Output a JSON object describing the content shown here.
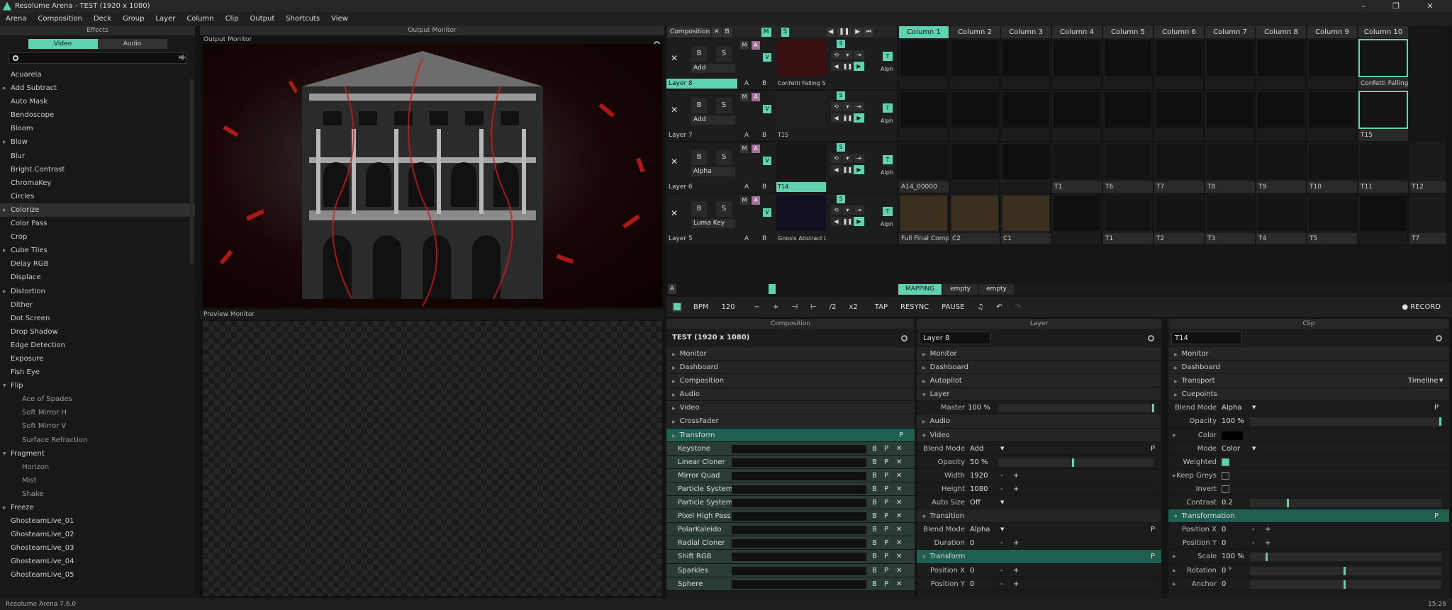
{
  "window": {
    "title": "Resolume Arena - TEST (1920 x 1080)",
    "min": "–",
    "max": "❐",
    "close": "✕"
  },
  "menu": [
    "Arena",
    "Composition",
    "Deck",
    "Group",
    "Layer",
    "Column",
    "Clip",
    "Output",
    "Shortcuts",
    "View"
  ],
  "effects": {
    "title": "Effects",
    "tab_video": "Video",
    "tab_audio": "Audio",
    "search_placeholder": "",
    "items": [
      {
        "label": "Acuarela",
        "type": "item"
      },
      {
        "label": "Add Subtract",
        "type": "expand"
      },
      {
        "label": "Auto Mask",
        "type": "item"
      },
      {
        "label": "Bendoscope",
        "type": "item"
      },
      {
        "label": "Bloom",
        "type": "item"
      },
      {
        "label": "Blow",
        "type": "expand"
      },
      {
        "label": "Blur",
        "type": "item"
      },
      {
        "label": "Bright.Contrast",
        "type": "item"
      },
      {
        "label": "ChromaKey",
        "type": "item"
      },
      {
        "label": "Circles",
        "type": "item"
      },
      {
        "label": "Colorize",
        "type": "expand",
        "selected": true
      },
      {
        "label": "Color Pass",
        "type": "item"
      },
      {
        "label": "Crop",
        "type": "item"
      },
      {
        "label": "Cube Tiles",
        "type": "expand"
      },
      {
        "label": "Delay RGB",
        "type": "item"
      },
      {
        "label": "Displace",
        "type": "item"
      },
      {
        "label": "Distortion",
        "type": "expand"
      },
      {
        "label": "Dither",
        "type": "item"
      },
      {
        "label": "Dot Screen",
        "type": "item"
      },
      {
        "label": "Drop Shadow",
        "type": "item"
      },
      {
        "label": "Edge Detection",
        "type": "item"
      },
      {
        "label": "Exposure",
        "type": "item"
      },
      {
        "label": "Fish Eye",
        "type": "item"
      },
      {
        "label": "Flip",
        "type": "open"
      },
      {
        "label": "Ace of Spades",
        "type": "sub"
      },
      {
        "label": "Soft Mirror H",
        "type": "sub"
      },
      {
        "label": "Soft Mirror V",
        "type": "sub"
      },
      {
        "label": "Surface Refraction",
        "type": "sub"
      },
      {
        "label": "Fragment",
        "type": "open"
      },
      {
        "label": "Horizon",
        "type": "sub"
      },
      {
        "label": "Mist",
        "type": "sub"
      },
      {
        "label": "Shake",
        "type": "sub"
      },
      {
        "label": "Freeze",
        "type": "expand"
      },
      {
        "label": "GhosteamLive_01",
        "type": "item"
      },
      {
        "label": "GhosteamLive_02",
        "type": "item"
      },
      {
        "label": "GhosteamLive_03",
        "type": "item"
      },
      {
        "label": "GhosteamLive_04",
        "type": "item"
      },
      {
        "label": "GhosteamLive_05",
        "type": "item"
      }
    ]
  },
  "output_monitor": {
    "title": "Output Monitor",
    "label": "Output Monitor"
  },
  "preview_monitor": {
    "label": "Preview Monitor"
  },
  "composition_bar": {
    "label": "Composition",
    "x": "✕",
    "b": "B",
    "m": "M",
    "s": "S"
  },
  "columns": [
    "Column 1",
    "Column 2",
    "Column 3",
    "Column 4",
    "Column 5",
    "Column 6",
    "Column 7",
    "Column 8",
    "Column 9",
    "Column 10"
  ],
  "layers": [
    {
      "name": "Layer 8",
      "blend": "Add",
      "clip": "Confetti Falling Si...",
      "active": true,
      "cells": [
        "",
        "",
        "",
        "",
        "",
        "",
        "",
        "",
        "",
        "Confetti Falling Si..."
      ]
    },
    {
      "name": "Layer 7",
      "blend": "Add",
      "clip": "T15",
      "active": false,
      "cells": [
        "",
        "",
        "",
        "",
        "",
        "",
        "",
        "",
        "",
        "T15"
      ]
    },
    {
      "name": "Layer 6",
      "blend": "Alpha",
      "clip": "T14",
      "active": false,
      "clip_on": true,
      "cells": [
        "A14_00000",
        "",
        "",
        "T1",
        "T6",
        "T7",
        "T8",
        "T9",
        "T10",
        "T11"
      ]
    },
    {
      "name": "Layer 5",
      "blend": "Luma Key",
      "clip": "Gnosis Abstract Li...",
      "active": false,
      "cells": [
        "Full Final Comp",
        "C2",
        "C1",
        "",
        "T1",
        "T2",
        "T3",
        "T4",
        "T5",
        ""
      ]
    }
  ],
  "extra_col": {
    "row3": "T12",
    "row4": "T7"
  },
  "labels": {
    "a": "A",
    "b": "B",
    "s": "S",
    "m": "M",
    "v": "V",
    "t": "T",
    "alph": "Alph",
    "x": "✕"
  },
  "deck_tabs": [
    "MAPPING",
    "empty",
    "empty"
  ],
  "transport": {
    "bpm_label": "BPM",
    "bpm": "120",
    "minus": "−",
    "plus": "+",
    "half": "/2",
    "double": "x2",
    "tap": "TAP",
    "resync": "RESYNC",
    "pause": "PAUSE",
    "record": "● RECORD"
  },
  "composition": {
    "title": "Composition",
    "name": "TEST (1920 x 1080)",
    "groups": [
      "Monitor",
      "Dashboard",
      "Composition",
      "Audio",
      "Video",
      "CrossFader",
      "Transform"
    ],
    "effects": [
      "Keystone",
      "Linear Cloner",
      "Mirror Quad",
      "Particle System",
      "Particle System",
      "Pixel High Pass",
      "PolarKaleido",
      "Radial Cloner",
      "Shift RGB",
      "Sparkles",
      "Sphere"
    ],
    "btn_b": "B",
    "btn_p": "P",
    "btn_x": "✕"
  },
  "layer_panel": {
    "title": "Layer",
    "name": "Layer 8",
    "monitor": "Monitor",
    "dashboard": "Dashboard",
    "autopilot": "Autopilot",
    "layer": "Layer",
    "master_lbl": "Master",
    "master": "100 %",
    "audio": "Audio",
    "video": "Video",
    "blend_lbl": "Blend Mode",
    "blend": "Add",
    "opacity_lbl": "Opacity",
    "opacity": "50 %",
    "width_lbl": "Width",
    "width": "1920",
    "height_lbl": "Height",
    "height": "1080",
    "autosize_lbl": "Auto Size",
    "autosize": "Off",
    "transition": "Transition",
    "tblend": "Alpha",
    "duration_lbl": "Duration",
    "duration": "0",
    "transform": "Transform",
    "posx_lbl": "Position X",
    "posx": "0",
    "posy_lbl": "Position Y",
    "posy": "0",
    "minus": "-",
    "plus": "+",
    "p": "P"
  },
  "clip_panel": {
    "title": "Clip",
    "name": "T14",
    "monitor": "Monitor",
    "dashboard": "Dashboard",
    "transport": "Transport",
    "timeline": "Timeline",
    "cuepoints": "Cuepoints",
    "blend_lbl": "Blend Mode",
    "blend": "Alpha",
    "opacity_lbl": "Opacity",
    "opacity": "100 %",
    "color_lbl": "Color",
    "mode_lbl": "Mode",
    "mode": "Color",
    "weighted_lbl": "Weighted",
    "keepgreys_lbl": "Keep Greys",
    "invert_lbl": "Invert",
    "contrast_lbl": "Contrast",
    "contrast": "0.2",
    "transformation": "Transformation",
    "posx_lbl": "Position X",
    "posx": "0",
    "posy_lbl": "Position Y",
    "posy": "0",
    "scale_lbl": "Scale",
    "scale": "100 %",
    "rotation_lbl": "Rotation",
    "rotation": "0 °",
    "anchor_lbl": "Anchor",
    "anchor": "0",
    "minus": "-",
    "plus": "+",
    "p": "P"
  },
  "status": {
    "version": "Resolume Arena 7.6.0",
    "time": "15:26"
  }
}
